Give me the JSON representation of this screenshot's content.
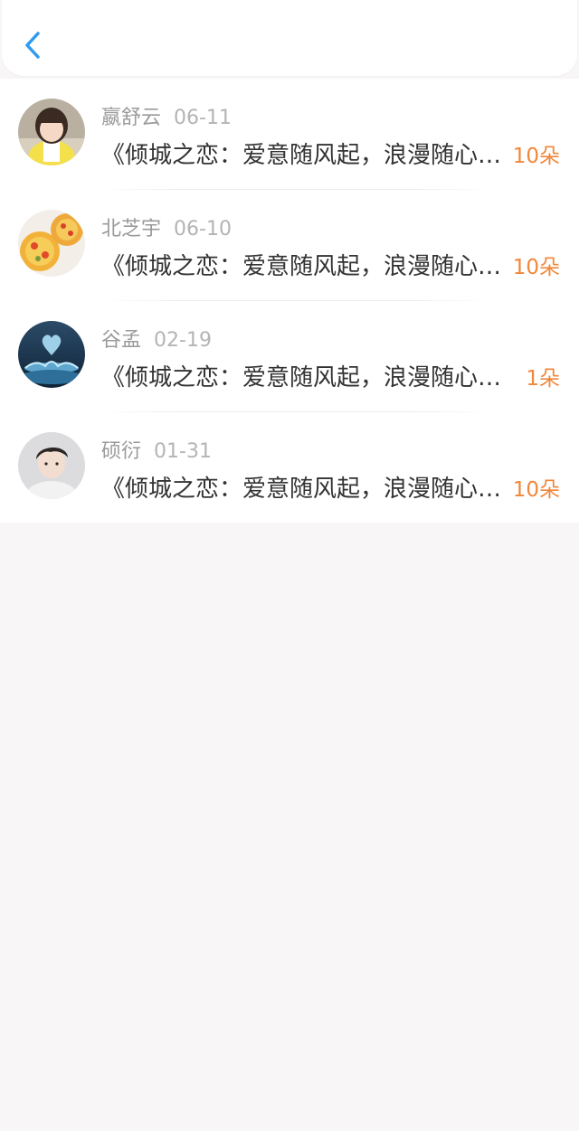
{
  "header": {
    "back_icon": "chevron-left-icon",
    "accent_color": "#2e9bf0"
  },
  "list": {
    "count_color": "#f0873a",
    "items": [
      {
        "name": "嬴舒云",
        "date": "06-11",
        "title": "《倾城之恋：爱意随风起，浪漫随心生》",
        "count": "10朵"
      },
      {
        "name": "北芝宇",
        "date": "06-10",
        "title": "《倾城之恋：爱意随风起，浪漫随心生》",
        "count": "10朵"
      },
      {
        "name": "谷孟",
        "date": "02-19",
        "title": "《倾城之恋：爱意随风起，浪漫随心生》",
        "count": "1朵"
      },
      {
        "name": "硕衍",
        "date": "01-31",
        "title": "《倾城之恋：爱意随风起，浪漫随心生》",
        "count": "10朵"
      }
    ]
  }
}
